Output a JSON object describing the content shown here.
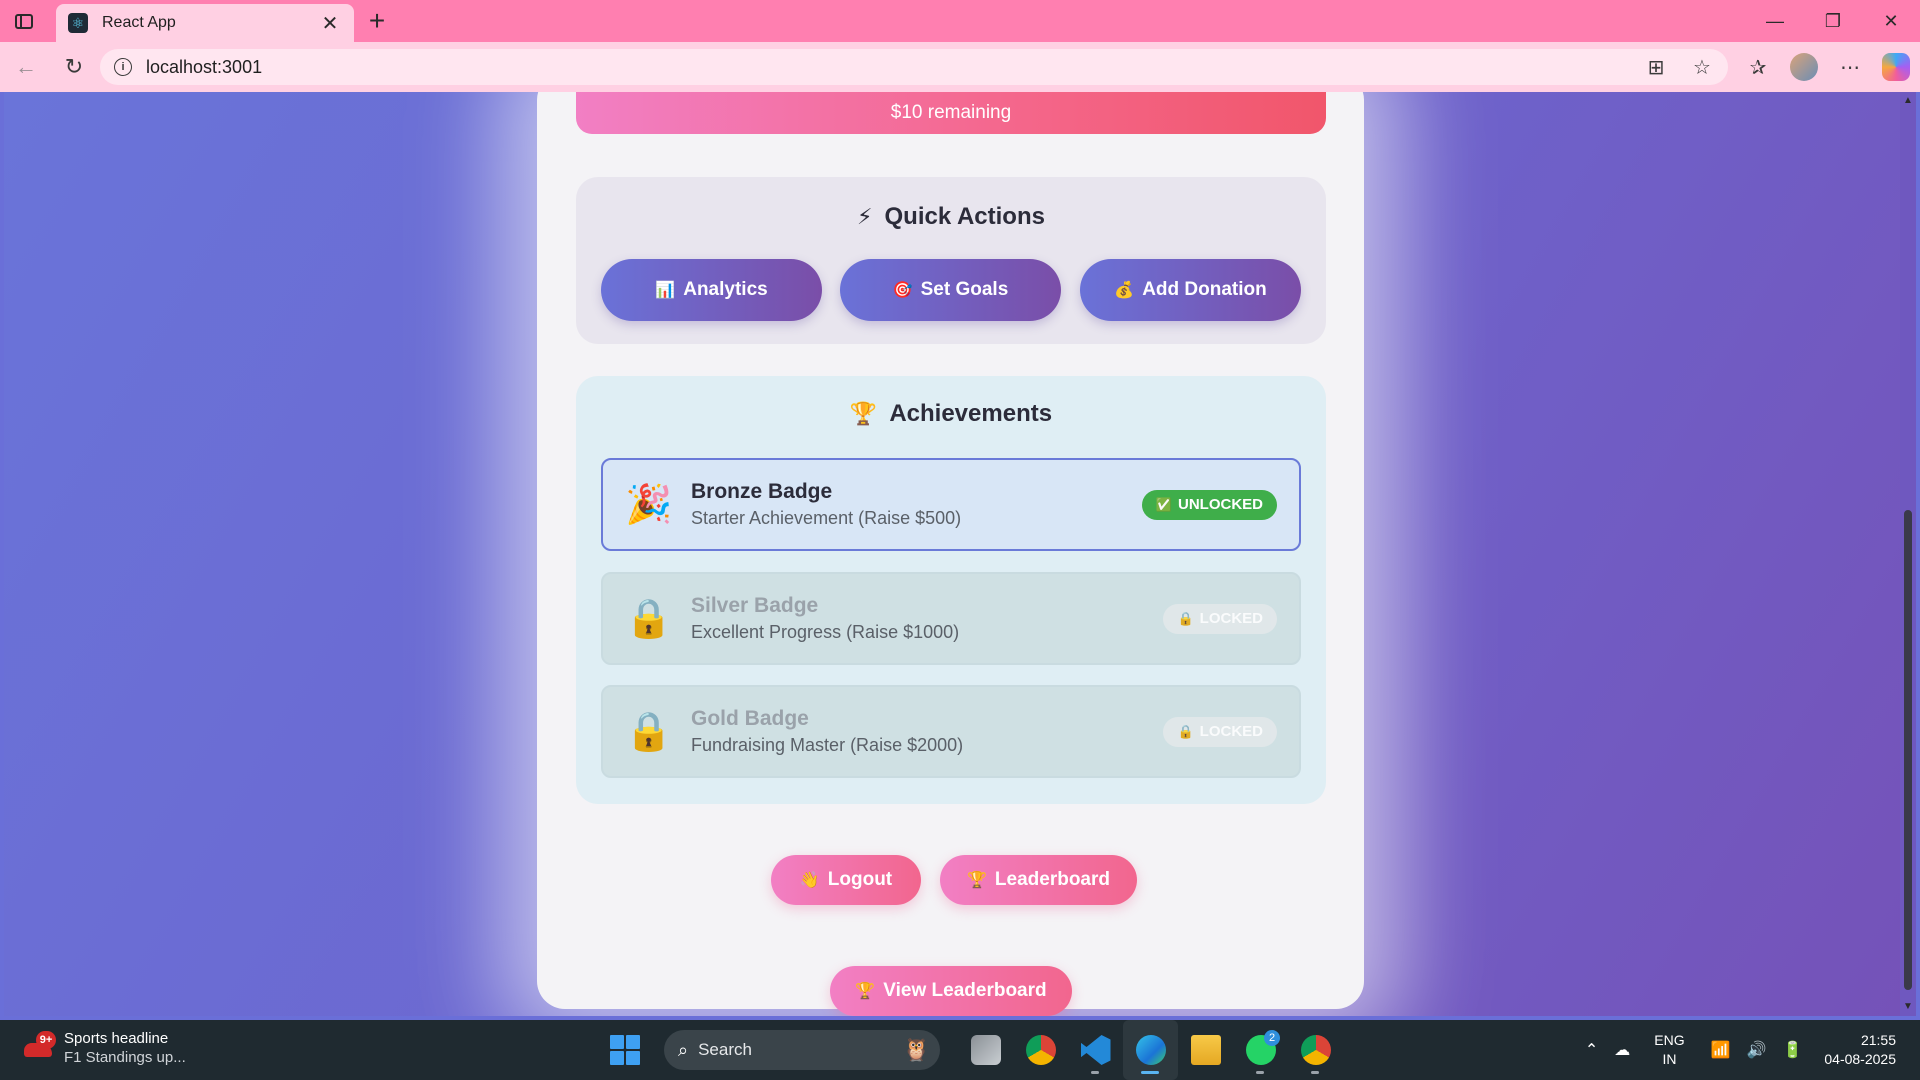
{
  "browser": {
    "tab_title": "React App",
    "url": "localhost:3001"
  },
  "page": {
    "remaining_text": "$10 remaining",
    "quick_actions": {
      "title": "Quick Actions",
      "title_emoji": "⚡",
      "buttons": [
        {
          "emoji": "📊",
          "label": "Analytics"
        },
        {
          "emoji": "🎯",
          "label": "Set Goals"
        },
        {
          "emoji": "💰",
          "label": "Add Donation"
        }
      ]
    },
    "achievements": {
      "title": "Achievements",
      "title_emoji": "🏆",
      "items": [
        {
          "emoji": "🎉",
          "name": "Bronze Badge",
          "desc": "Starter Achievement (Raise $500)",
          "status_emoji": "✅",
          "status": "UNLOCKED"
        },
        {
          "emoji": "🔒",
          "name": "Silver Badge",
          "desc": "Excellent Progress (Raise $1000)",
          "status_emoji": "🔒",
          "status": "LOCKED"
        },
        {
          "emoji": "🔒",
          "name": "Gold Badge",
          "desc": "Fundraising Master (Raise $2000)",
          "status_emoji": "🔒",
          "status": "LOCKED"
        }
      ]
    },
    "logout": {
      "emoji": "👋",
      "label": "Logout"
    },
    "leaderboard": {
      "emoji": "🏆",
      "label": "Leaderboard"
    },
    "view_leaderboard": {
      "emoji": "🏆",
      "label": "View Leaderboard"
    }
  },
  "taskbar": {
    "news_badge": "9+",
    "news_title": "Sports headline",
    "news_sub": "F1 Standings up...",
    "search_label": "Search",
    "whatsapp_count": "2",
    "lang_top": "ENG",
    "lang_bottom": "IN",
    "time": "21:55",
    "date": "04-08-2025"
  },
  "colors": {
    "accent_purple": "#6a72d8",
    "pink": "#f27fc4",
    "unlocked_green": "#3fae4a"
  }
}
